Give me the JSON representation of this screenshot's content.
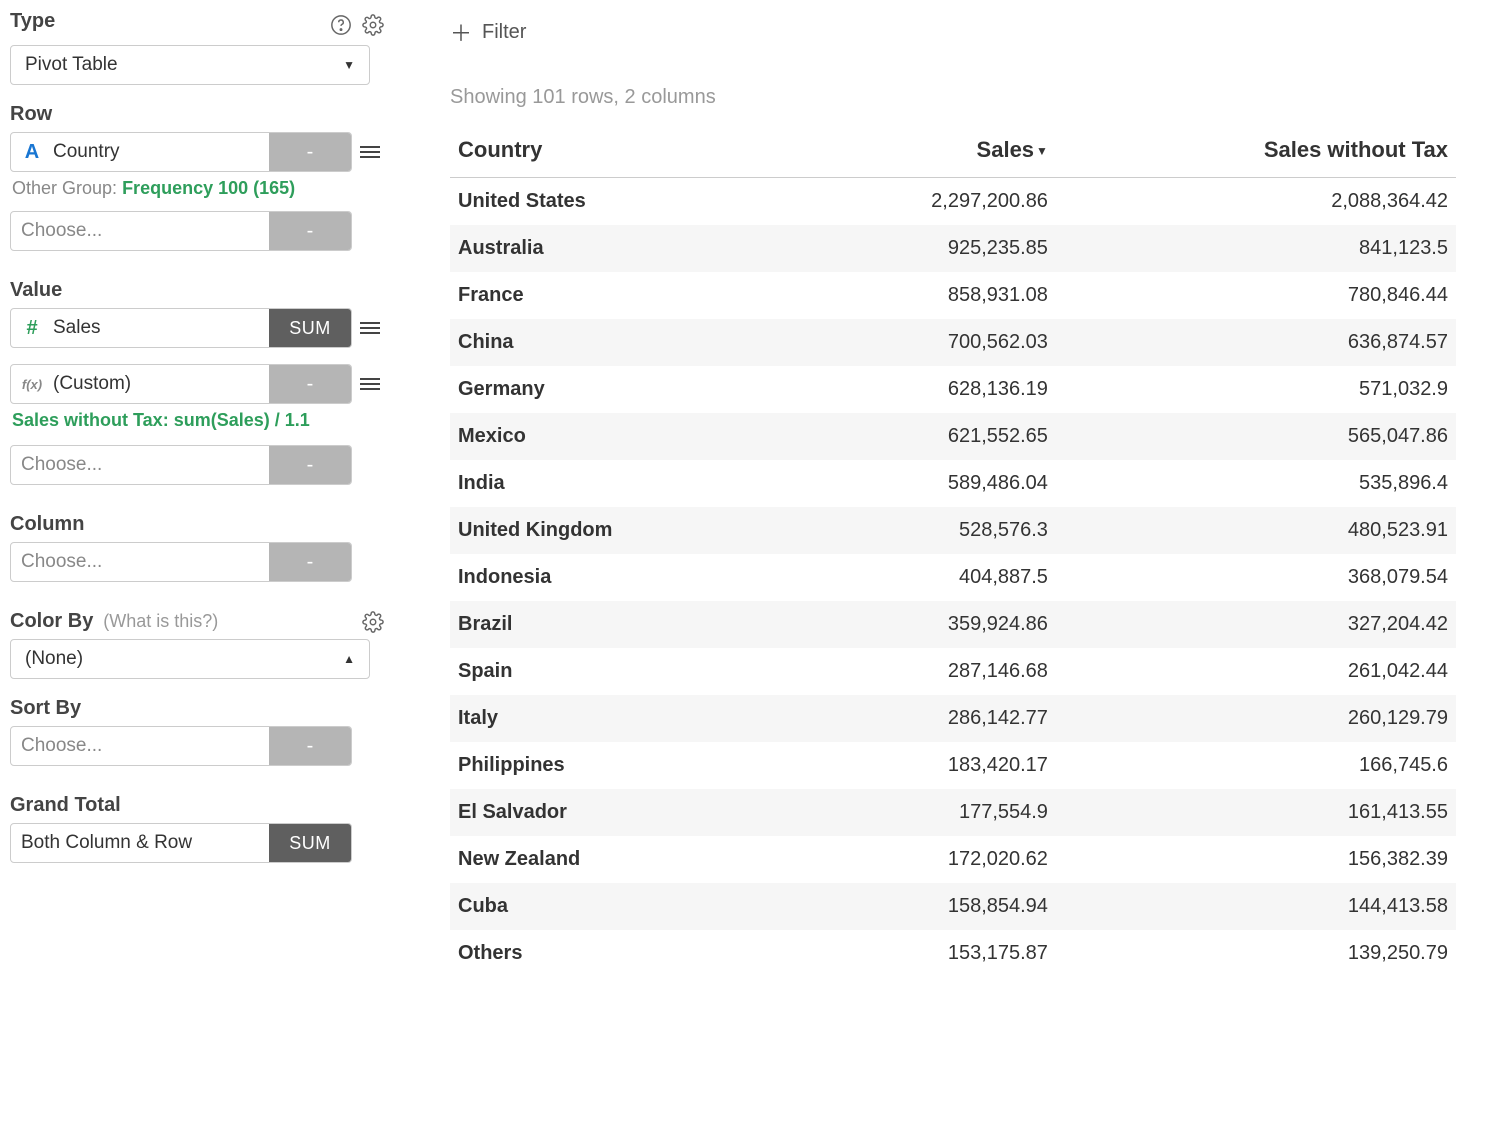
{
  "sidebar": {
    "type": {
      "label": "Type",
      "value": "Pivot Table"
    },
    "row": {
      "label": "Row",
      "fields": [
        {
          "icon": "text",
          "name": "Country",
          "badge": "-"
        }
      ],
      "other_group_prefix": "Other Group: ",
      "other_group_value": "Frequency 100 (165)",
      "choose_placeholder": "Choose...",
      "choose_badge": "-"
    },
    "value": {
      "label": "Value",
      "fields": [
        {
          "icon": "num",
          "name": "Sales",
          "badge": "SUM",
          "badge_dark": true
        },
        {
          "icon": "fx",
          "name": "(Custom)",
          "badge": "-"
        }
      ],
      "formula": "Sales without Tax: sum(Sales) / 1.1",
      "choose_placeholder": "Choose...",
      "choose_badge": "-"
    },
    "column": {
      "label": "Column",
      "choose_placeholder": "Choose...",
      "choose_badge": "-"
    },
    "color_by": {
      "label": "Color By",
      "hint": "(What is this?)",
      "value": "(None)"
    },
    "sort_by": {
      "label": "Sort By",
      "choose_placeholder": "Choose...",
      "choose_badge": "-"
    },
    "grand_total": {
      "label": "Grand Total",
      "value": "Both Column & Row",
      "badge": "SUM"
    }
  },
  "main": {
    "filter_label": "Filter",
    "summary": "Showing 101 rows, 2 columns",
    "headers": {
      "country": "Country",
      "sales": "Sales",
      "sales_no_tax": "Sales without Tax"
    },
    "rows": [
      {
        "country": "United States",
        "sales": "2,297,200.86",
        "nt": "2,088,364.42"
      },
      {
        "country": "Australia",
        "sales": "925,235.85",
        "nt": "841,123.5"
      },
      {
        "country": "France",
        "sales": "858,931.08",
        "nt": "780,846.44"
      },
      {
        "country": "China",
        "sales": "700,562.03",
        "nt": "636,874.57"
      },
      {
        "country": "Germany",
        "sales": "628,136.19",
        "nt": "571,032.9"
      },
      {
        "country": "Mexico",
        "sales": "621,552.65",
        "nt": "565,047.86"
      },
      {
        "country": "India",
        "sales": "589,486.04",
        "nt": "535,896.4"
      },
      {
        "country": "United Kingdom",
        "sales": "528,576.3",
        "nt": "480,523.91"
      },
      {
        "country": "Indonesia",
        "sales": "404,887.5",
        "nt": "368,079.54"
      },
      {
        "country": "Brazil",
        "sales": "359,924.86",
        "nt": "327,204.42"
      },
      {
        "country": "Spain",
        "sales": "287,146.68",
        "nt": "261,042.44"
      },
      {
        "country": "Italy",
        "sales": "286,142.77",
        "nt": "260,129.79"
      },
      {
        "country": "Philippines",
        "sales": "183,420.17",
        "nt": "166,745.6"
      },
      {
        "country": "El Salvador",
        "sales": "177,554.9",
        "nt": "161,413.55"
      },
      {
        "country": "New Zealand",
        "sales": "172,020.62",
        "nt": "156,382.39"
      },
      {
        "country": "Cuba",
        "sales": "158,854.94",
        "nt": "144,413.58"
      },
      {
        "country": "Others",
        "sales": "153,175.87",
        "nt": "139,250.79"
      }
    ]
  },
  "chart_data": {
    "type": "table",
    "columns": [
      "Country",
      "Sales",
      "Sales without Tax"
    ],
    "rows": [
      [
        "United States",
        2297200.86,
        2088364.42
      ],
      [
        "Australia",
        925235.85,
        841123.5
      ],
      [
        "France",
        858931.08,
        780846.44
      ],
      [
        "China",
        700562.03,
        636874.57
      ],
      [
        "Germany",
        628136.19,
        571032.9
      ],
      [
        "Mexico",
        621552.65,
        565047.86
      ],
      [
        "India",
        589486.04,
        535896.4
      ],
      [
        "United Kingdom",
        528576.3,
        480523.91
      ],
      [
        "Indonesia",
        404887.5,
        368079.54
      ],
      [
        "Brazil",
        359924.86,
        327204.42
      ],
      [
        "Spain",
        287146.68,
        261042.44
      ],
      [
        "Italy",
        286142.77,
        260129.79
      ],
      [
        "Philippines",
        183420.17,
        166745.6
      ],
      [
        "El Salvador",
        177554.9,
        161413.55
      ],
      [
        "New Zealand",
        172020.62,
        156382.39
      ],
      [
        "Cuba",
        158854.94,
        144413.58
      ],
      [
        "Others",
        153175.87,
        139250.79
      ]
    ],
    "sort": {
      "column": "Sales",
      "direction": "desc"
    },
    "total_rows": 101,
    "total_columns": 2
  }
}
